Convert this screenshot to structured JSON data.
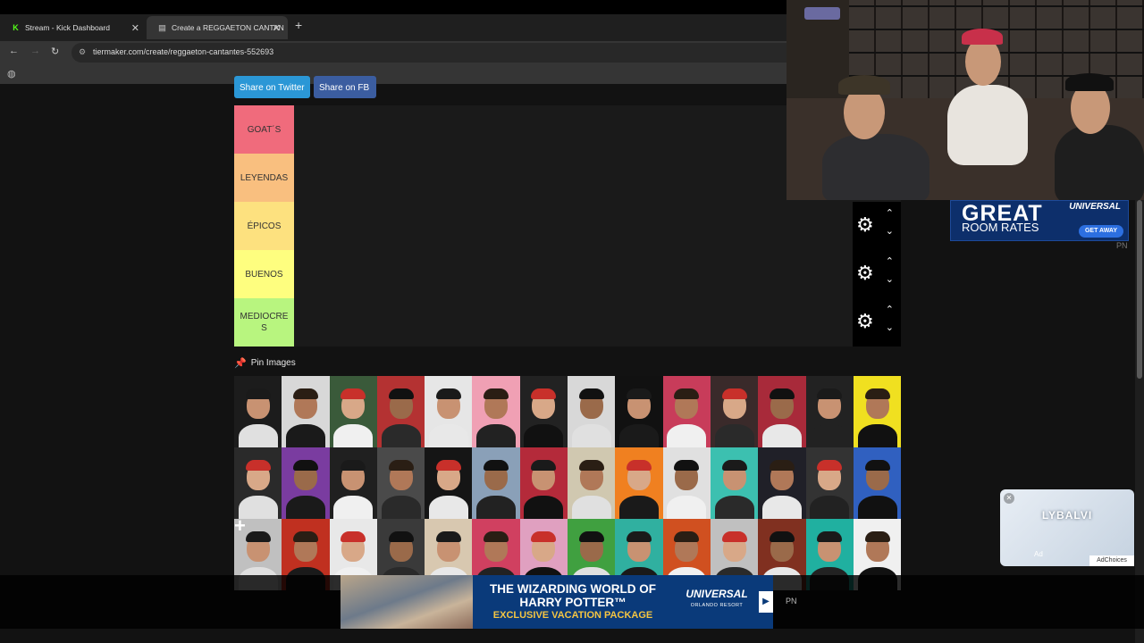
{
  "browser": {
    "tabs": [
      {
        "label": "Stream - Kick Dashboard",
        "icon": "kick-icon",
        "active": false
      },
      {
        "label": "Create a REGGAETON CANTAN",
        "icon": "tiermaker-icon",
        "active": true
      }
    ],
    "url": "tiermaker.com/create/reggaeton-cantantes-552693"
  },
  "page": {
    "share_twitter": "Share on Twitter",
    "share_fb": "Share on FB",
    "tiers": [
      {
        "label": "GOAT´S",
        "color": "#f06b7c"
      },
      {
        "label": "LEYENDAS",
        "color": "#f9bf7f"
      },
      {
        "label": "ÉPICOS",
        "color": "#fde17f"
      },
      {
        "label": "BUENOS",
        "color": "#fefe7f"
      },
      {
        "label": "MEDIOCRE S",
        "color": "#b8f57f"
      }
    ],
    "pin_images": "Pin Images"
  },
  "ads": {
    "bottom": {
      "title": "THE WIZARDING WORLD OF HARRY POTTER™",
      "subtitle": "EXCLUSIVE VACATION PACKAGE",
      "brand": "UNIVERSAL",
      "brand_sub": "ORLANDO RESORT",
      "pn": "PN"
    },
    "right": {
      "headline": "GREAT",
      "sub": "ROOM RATES",
      "brand": "UNIVERSAL",
      "cta": "GET AWAY",
      "pn": "PN"
    },
    "video": {
      "brand": "LYBALVI",
      "label": "Ad",
      "adchoices": "AdChoices"
    }
  }
}
